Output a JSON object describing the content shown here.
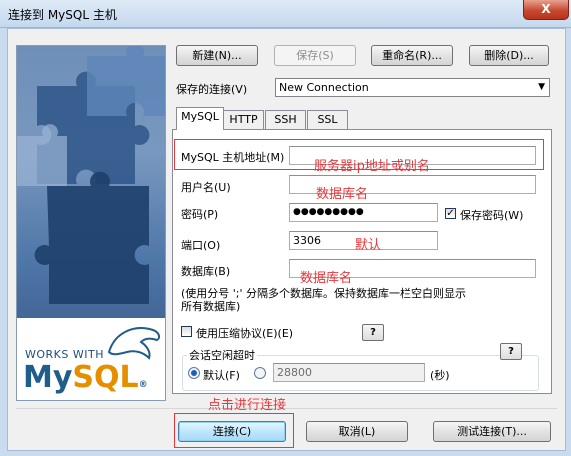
{
  "window": {
    "title": "连接到 MySQL 主机",
    "close_label": "X"
  },
  "side_image": {
    "badge": "WORKS WITH",
    "logo_my": "My",
    "logo_sql": "SQL",
    "logo_r": "®"
  },
  "toolbar": {
    "new_label": "新建(N)...",
    "save_label": "保存(S)",
    "rename_label": "重命名(R)...",
    "delete_label": "删除(D)..."
  },
  "saved_connection": {
    "label": "保存的连接(V)",
    "value": "New Connection"
  },
  "tabs": [
    {
      "label": "MySQL",
      "active": true
    },
    {
      "label": "HTTP",
      "active": false
    },
    {
      "label": "SSH",
      "active": false
    },
    {
      "label": "SSL",
      "active": false
    }
  ],
  "form": {
    "host_label": "MySQL 主机地址(M)",
    "host_value": "",
    "user_label": "用户名(U)",
    "user_value": "",
    "password_label": "密码(P)",
    "password_value": "●●●●●●●●●",
    "save_password_label": "保存密码(W)",
    "save_password_checked": true,
    "port_label": "端口(O)",
    "port_value": "3306",
    "database_label": "数据库(B)",
    "database_value": "",
    "database_hint": "(使用分号 ';' 分隔多个数据库。保持数据库一栏空白则显示所有数据库)",
    "compression_label": "使用压缩协议(E)(E)",
    "compression_checked": false,
    "help_label": "?",
    "timeout_group_label": "会话空闲超时",
    "default_label": "默认(F)",
    "timeout_value": "28800",
    "seconds_label": "(秒)"
  },
  "annotations": {
    "host": "服务器ip地址或别名",
    "user": "数据库名",
    "port": "默认",
    "database": "数据库名",
    "connect": "点击进行连接"
  },
  "footer": {
    "connect_label": "连接(C)",
    "cancel_label": "取消(L)",
    "test_label": "测试连接(T)..."
  },
  "colors": {
    "annotation": "#e8383b",
    "title_bar": "#c4d8ee",
    "logo_blue": "#1f5d8b",
    "logo_orange": "#e48e00"
  }
}
